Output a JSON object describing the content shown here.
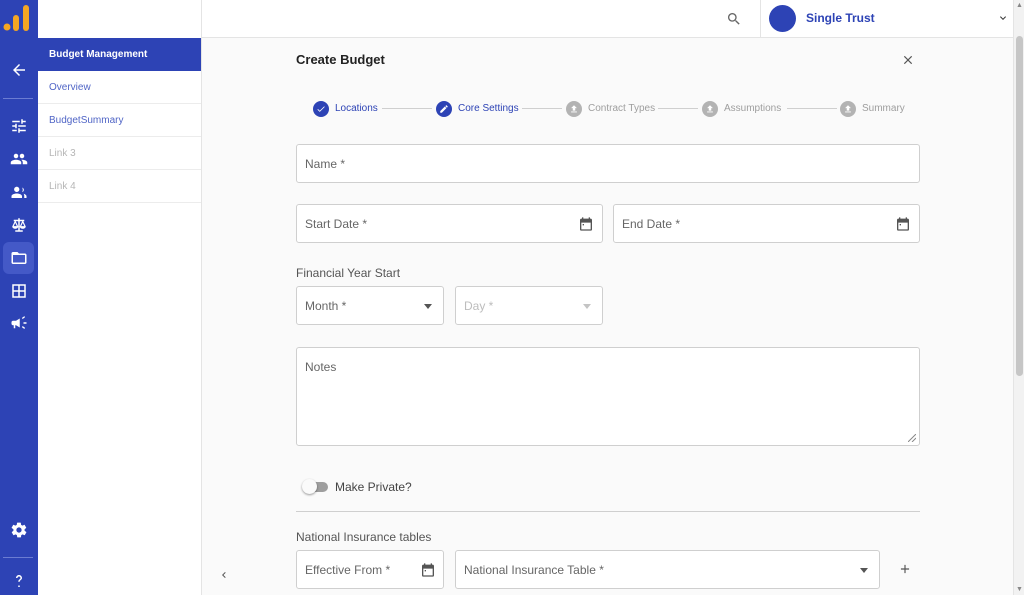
{
  "topbar": {
    "user_name": "Single Trust"
  },
  "subnav": {
    "section_title": "Budget Management",
    "items": [
      {
        "label": "Overview",
        "disabled": false
      },
      {
        "label": "BudgetSummary",
        "disabled": false
      },
      {
        "label": "Link 3",
        "disabled": true
      },
      {
        "label": "Link 4",
        "disabled": true
      }
    ]
  },
  "form": {
    "title": "Create Budget",
    "steps": [
      {
        "label": "Locations",
        "state": "done",
        "icon": "check-icon"
      },
      {
        "label": "Core Settings",
        "state": "active",
        "icon": "pencil-icon"
      },
      {
        "label": "Contract Types",
        "state": "pending",
        "icon": "upload-icon"
      },
      {
        "label": "Assumptions",
        "state": "pending",
        "icon": "upload-icon"
      },
      {
        "label": "Summary",
        "state": "pending",
        "icon": "upload-icon"
      }
    ],
    "name_label": "Name *",
    "start_date_label": "Start Date *",
    "end_date_label": "End Date *",
    "financial_year_label": "Financial Year Start",
    "month_label": "Month *",
    "day_label": "Day *",
    "notes_label": "Notes",
    "make_private_label": "Make Private?",
    "make_private_value": false,
    "ni_tables_label": "National Insurance tables",
    "effective_from_label": "Effective From *",
    "ni_table_label": "National Insurance Table *"
  },
  "colors": {
    "primary": "#2d43b5",
    "rail_active": "#4459c7",
    "disabled": "#b3b3b3"
  }
}
